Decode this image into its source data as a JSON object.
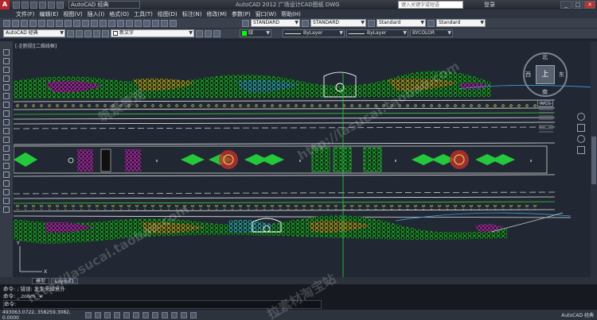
{
  "titlebar": {
    "workspace": "AutoCAD 经典",
    "title": "AutoCAD 2012  广场设计CAD图纸 DWG",
    "search_placeholder": "键入关键字或短语",
    "login": "登录"
  },
  "menu": [
    "文件(F)",
    "编辑(E)",
    "视图(V)",
    "插入(I)",
    "格式(O)",
    "工具(T)",
    "绘图(D)",
    "标注(N)",
    "修改(M)",
    "参数(P)",
    "窗口(W)",
    "帮助(H)"
  ],
  "toolbar1": {
    "style1": "STANDARD",
    "style2": "STANDARD",
    "style3": "Standard",
    "style4": "Standard"
  },
  "toolbar2": {
    "workspace": "AutoCAD 经典",
    "layer": "新文字",
    "color": "绿",
    "linetype": "ByLayer",
    "lineweight": "ByLayer",
    "plotstyle": "BYCOLOR"
  },
  "viewport_label": "[-][俯视][二维线框]",
  "compass": {
    "north": "北",
    "south": "南",
    "west": "西",
    "east": "东",
    "top": "上",
    "wcs": "WCS"
  },
  "tabs": [
    "模型",
    "Layout1"
  ],
  "command": {
    "line1": "命令: ; 错误: 发生未知意外",
    "line2": "命令: _.zoom _e",
    "line3": "命令:"
  },
  "status": {
    "coords": "493063.0722, 358259.3082, 0.0000",
    "right": "AutoCAD 经典"
  },
  "watermarks": [
    "http://lasucai.taobao.com",
    "筑景景观",
    "拉素材淘宝站"
  ]
}
